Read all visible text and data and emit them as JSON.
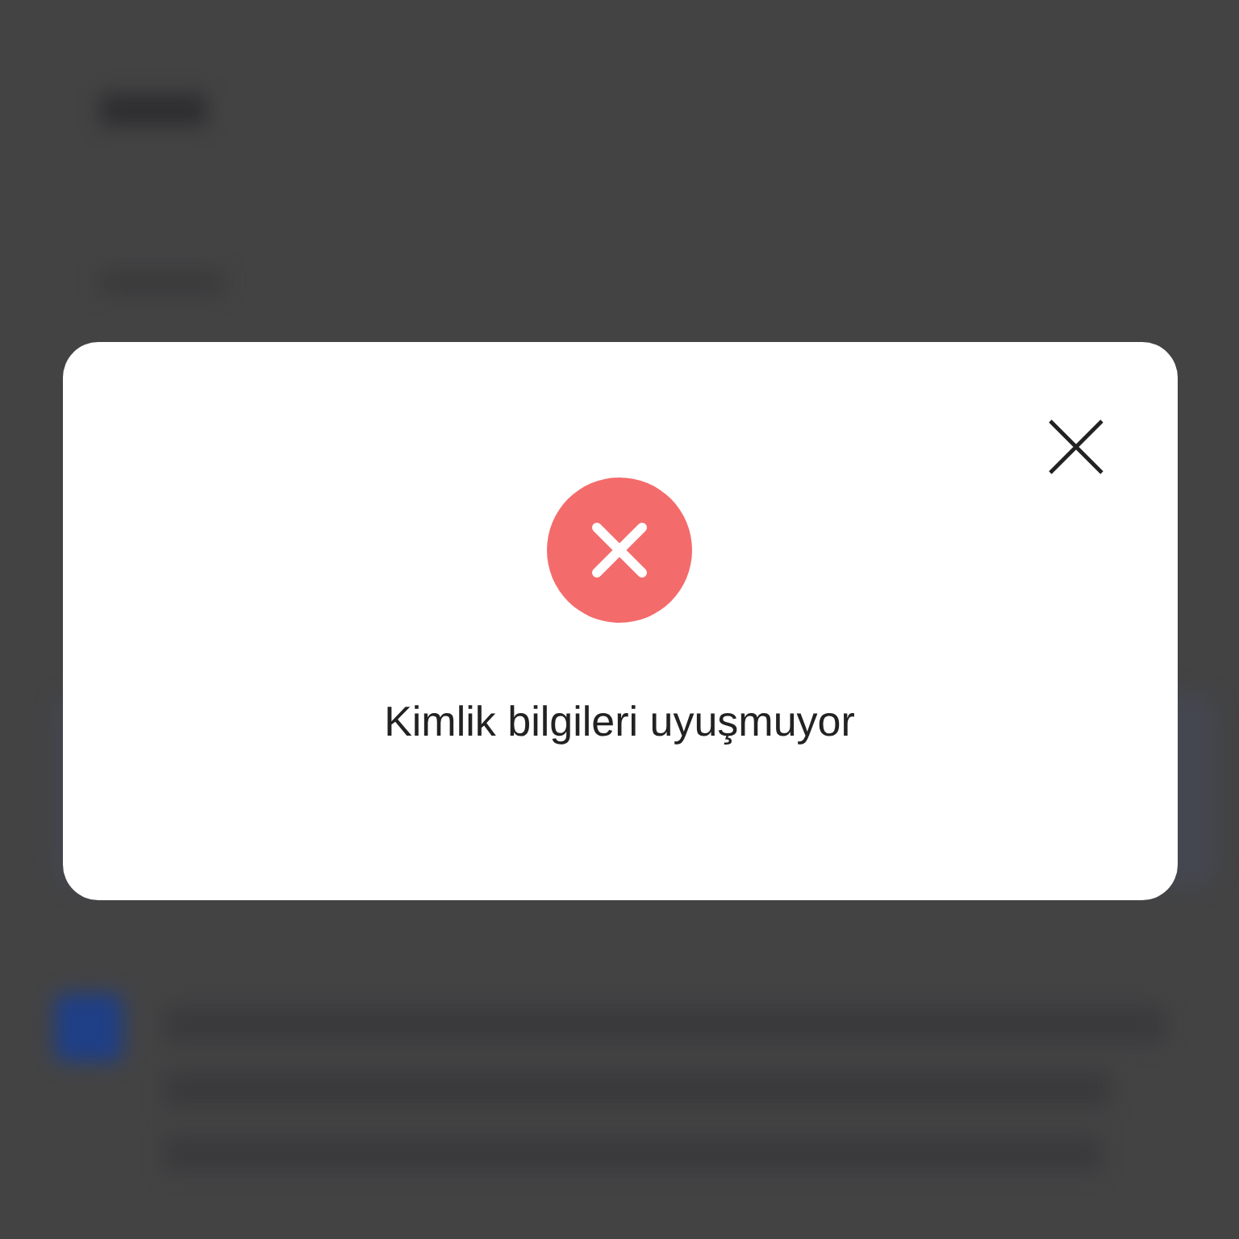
{
  "dialog": {
    "kind": "error",
    "message": "Kimlik bilgileri uyuşmuyor"
  }
}
